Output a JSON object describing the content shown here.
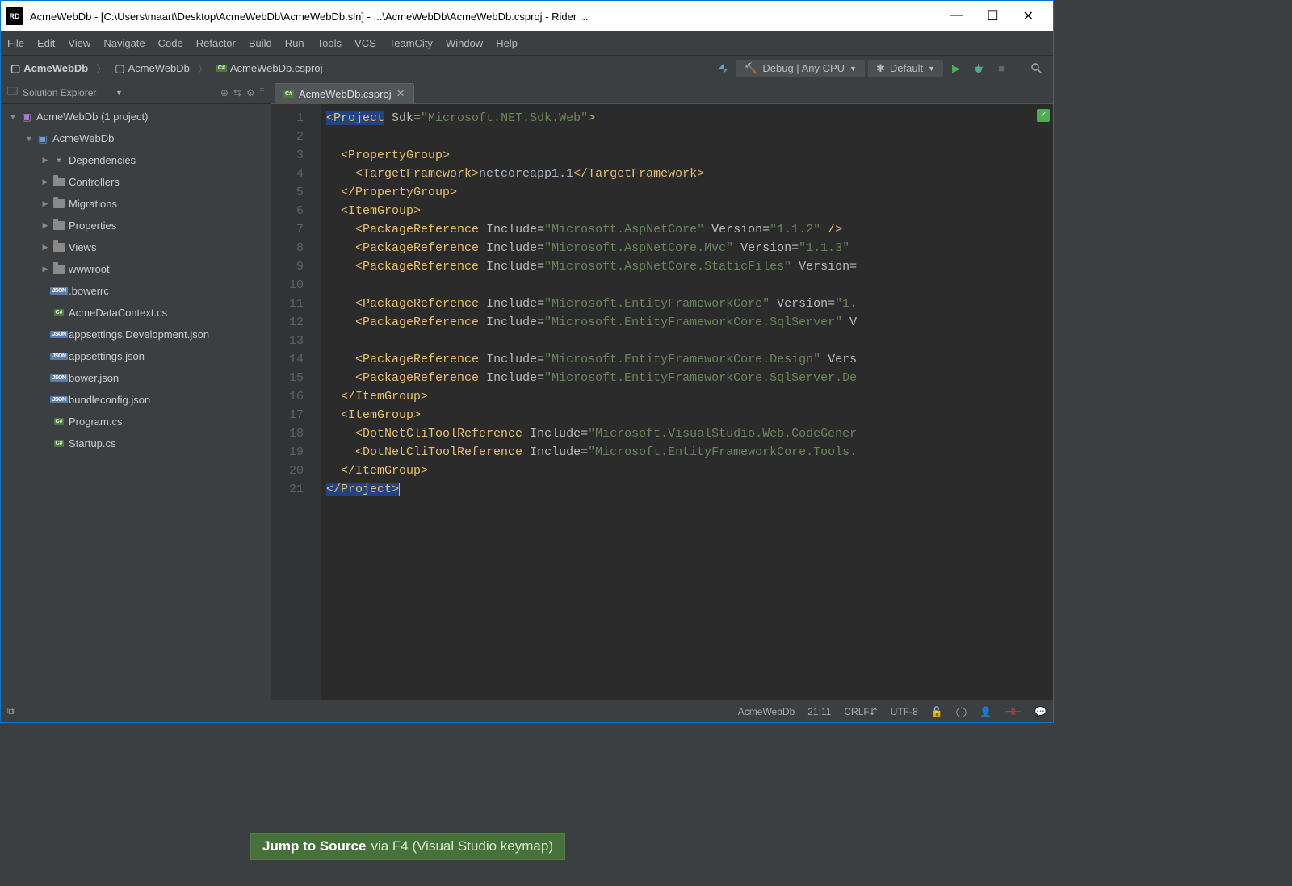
{
  "titlebar": {
    "app_badge": "RD",
    "title": "AcmeWebDb - [C:\\Users\\maart\\Desktop\\AcmeWebDb\\AcmeWebDb.sln] - ...\\AcmeWebDb\\AcmeWebDb.csproj - Rider ..."
  },
  "menu": [
    "File",
    "Edit",
    "View",
    "Navigate",
    "Code",
    "Refactor",
    "Build",
    "Run",
    "Tools",
    "VCS",
    "TeamCity",
    "Window",
    "Help"
  ],
  "breadcrumb": {
    "root": "AcmeWebDb",
    "project": "AcmeWebDb",
    "file": "AcmeWebDb.csproj"
  },
  "run_configs": {
    "debug": "Debug | Any CPU",
    "default": "Default"
  },
  "sidebar": {
    "title": "Solution Explorer",
    "tree": [
      {
        "depth": 0,
        "arrow": "▼",
        "icon": "sln",
        "label": "AcmeWebDb (1 project)"
      },
      {
        "depth": 1,
        "arrow": "▼",
        "icon": "proj",
        "label": "AcmeWebDb"
      },
      {
        "depth": 2,
        "arrow": "▶",
        "icon": "dep",
        "label": "Dependencies"
      },
      {
        "depth": 2,
        "arrow": "▶",
        "icon": "folder",
        "label": "Controllers"
      },
      {
        "depth": 2,
        "arrow": "▶",
        "icon": "folder",
        "label": "Migrations"
      },
      {
        "depth": 2,
        "arrow": "▶",
        "icon": "folder",
        "label": "Properties"
      },
      {
        "depth": 2,
        "arrow": "▶",
        "icon": "folder",
        "label": "Views"
      },
      {
        "depth": 2,
        "arrow": "▶",
        "icon": "folder",
        "label": "wwwroot"
      },
      {
        "depth": 2,
        "arrow": "",
        "icon": "json",
        "label": ".bowerrc"
      },
      {
        "depth": 2,
        "arrow": "",
        "icon": "cs",
        "label": "AcmeDataContext.cs"
      },
      {
        "depth": 2,
        "arrow": "",
        "icon": "json",
        "label": "appsettings.Development.json"
      },
      {
        "depth": 2,
        "arrow": "",
        "icon": "json",
        "label": "appsettings.json"
      },
      {
        "depth": 2,
        "arrow": "",
        "icon": "json",
        "label": "bower.json"
      },
      {
        "depth": 2,
        "arrow": "",
        "icon": "json",
        "label": "bundleconfig.json"
      },
      {
        "depth": 2,
        "arrow": "",
        "icon": "cs",
        "label": "Program.cs"
      },
      {
        "depth": 2,
        "arrow": "",
        "icon": "cs",
        "label": "Startup.cs"
      }
    ]
  },
  "editor": {
    "tab_label": "AcmeWebDb.csproj",
    "lines": [
      {
        "n": 1,
        "html": "<span class='sel'>&lt;Project</span> <span class='attr'>Sdk=</span><span class='str'>\"Microsoft.NET.Sdk.Web\"</span><span class='tag'>&gt;</span>"
      },
      {
        "n": 2,
        "html": ""
      },
      {
        "n": 3,
        "html": "  <span class='tag'>&lt;PropertyGroup&gt;</span>"
      },
      {
        "n": 4,
        "html": "    <span class='tag'>&lt;TargetFramework&gt;</span>netcoreapp1.1<span class='tag'>&lt;/TargetFramework&gt;</span>"
      },
      {
        "n": 5,
        "html": "  <span class='tag'>&lt;/PropertyGroup&gt;</span>"
      },
      {
        "n": 6,
        "html": "  <span class='tag'>&lt;ItemGroup&gt;</span>"
      },
      {
        "n": 7,
        "html": "    <span class='tag'>&lt;PackageReference</span> <span class='attr'>Include=</span><span class='str'>\"Microsoft.AspNetCore\"</span> <span class='attr'>Version=</span><span class='str'>\"1.1.2\"</span> <span class='tag'>/&gt;</span>"
      },
      {
        "n": 8,
        "html": "    <span class='tag'>&lt;PackageReference</span> <span class='attr'>Include=</span><span class='str'>\"Microsoft.AspNetCore.Mvc\"</span> <span class='attr'>Version=</span><span class='str'>\"1.1.3\"</span>"
      },
      {
        "n": 9,
        "html": "    <span class='tag'>&lt;PackageReference</span> <span class='attr'>Include=</span><span class='str'>\"Microsoft.AspNetCore.StaticFiles\"</span> <span class='attr'>Version=</span>"
      },
      {
        "n": 10,
        "html": ""
      },
      {
        "n": 11,
        "html": "    <span class='tag'>&lt;PackageReference</span> <span class='attr'>Include=</span><span class='str'>\"Microsoft.EntityFrameworkCore\"</span> <span class='attr'>Version=</span><span class='str'>\"1.</span>"
      },
      {
        "n": 12,
        "html": "    <span class='tag'>&lt;PackageReference</span> <span class='attr'>Include=</span><span class='str'>\"Microsoft.EntityFrameworkCore.SqlServer\"</span> <span class='attr'>V</span>"
      },
      {
        "n": 13,
        "html": ""
      },
      {
        "n": 14,
        "html": "    <span class='tag'>&lt;PackageReference</span> <span class='attr'>Include=</span><span class='str'>\"Microsoft.EntityFrameworkCore.Design\"</span> <span class='attr'>Vers</span>"
      },
      {
        "n": 15,
        "html": "    <span class='tag'>&lt;PackageReference</span> <span class='attr'>Include=</span><span class='str'>\"Microsoft.EntityFrameworkCore.SqlServer.De</span>"
      },
      {
        "n": 16,
        "html": "  <span class='tag'>&lt;/ItemGroup&gt;</span>"
      },
      {
        "n": 17,
        "html": "  <span class='tag'>&lt;ItemGroup&gt;</span>"
      },
      {
        "n": 18,
        "html": "    <span class='tag'>&lt;DotNetCliToolReference</span> <span class='attr'>Include=</span><span class='str'>\"Microsoft.VisualStudio.Web.CodeGener</span>"
      },
      {
        "n": 19,
        "html": "    <span class='tag'>&lt;DotNetCliToolReference</span> <span class='attr'>Include=</span><span class='str'>\"Microsoft.EntityFrameworkCore.Tools.</span>"
      },
      {
        "n": 20,
        "html": "  <span class='tag'>&lt;/ItemGroup&gt;</span>"
      },
      {
        "n": 21,
        "html": "<span class='sel'>&lt;/Project&gt;</span><span class='cur'></span>"
      }
    ]
  },
  "tip": {
    "bold": "Jump to Source",
    "rest": " via F4 (Visual Studio keymap)"
  },
  "statusbar": {
    "project": "AcmeWebDb",
    "pos": "21:11",
    "lineend": "CRLF",
    "encoding": "UTF-8"
  }
}
